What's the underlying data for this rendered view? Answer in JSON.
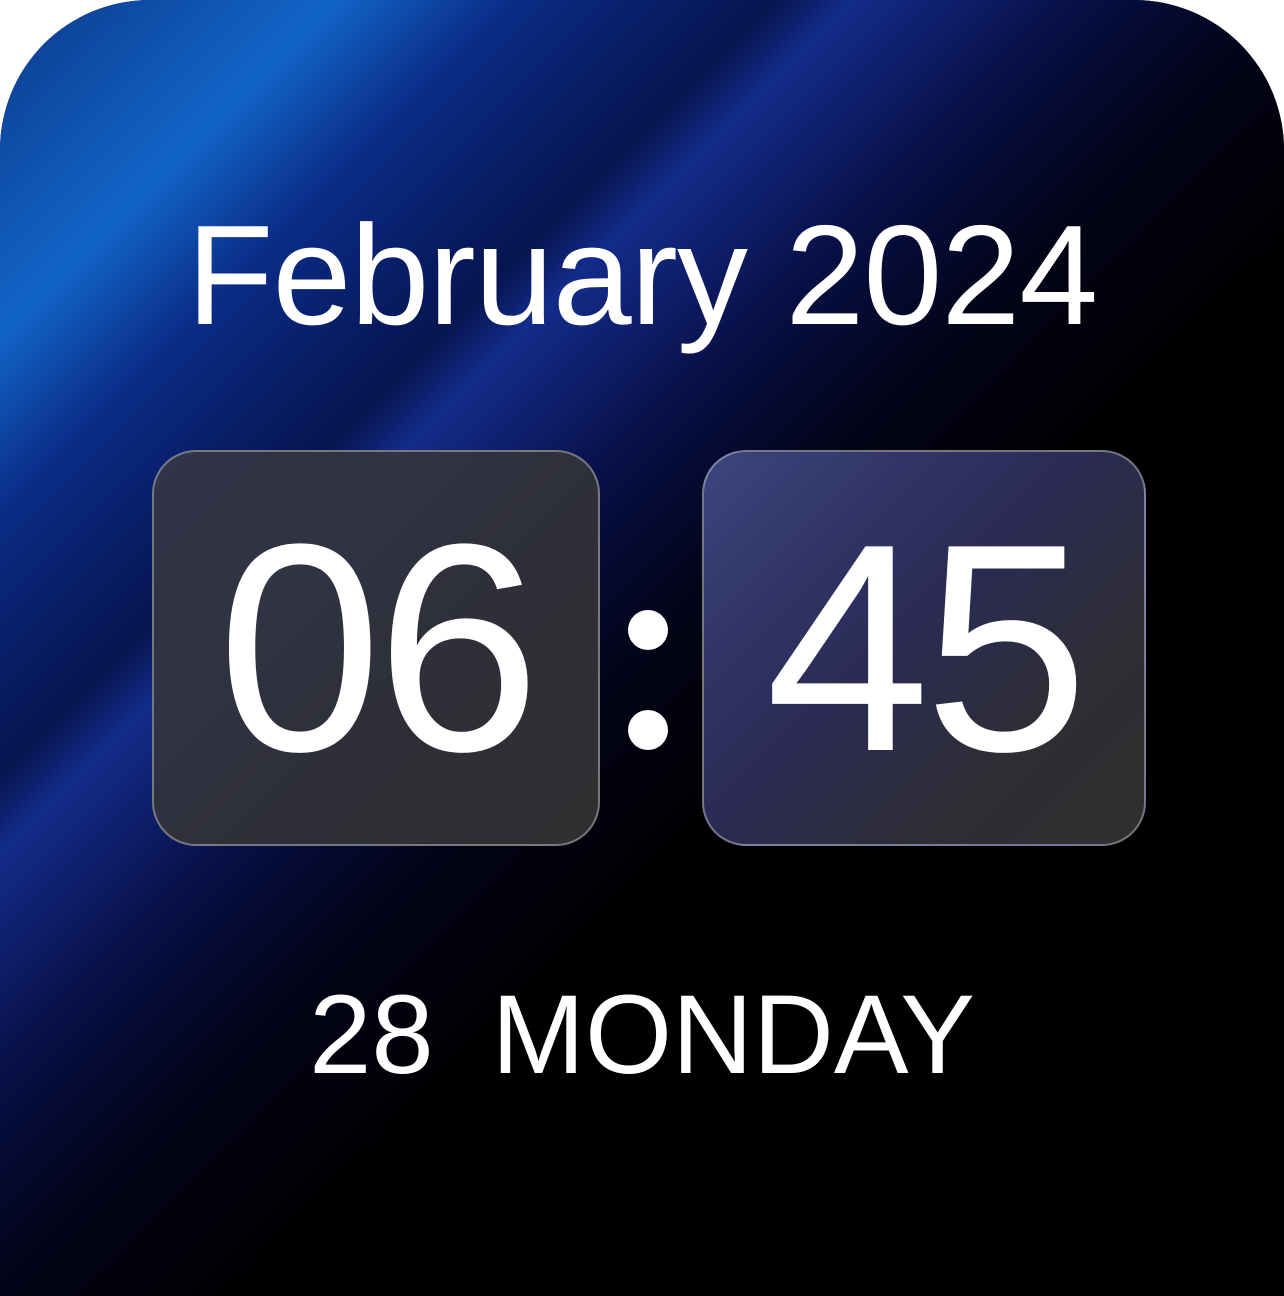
{
  "widget": {
    "month_year": "February 2024",
    "hours": "06",
    "minutes": "45",
    "day_number": "28",
    "weekday": "MONDAY"
  },
  "colors": {
    "text": "#ffffff",
    "tile": "#3a3a40",
    "background": "#000000",
    "accent_blue": "#1264c8"
  }
}
